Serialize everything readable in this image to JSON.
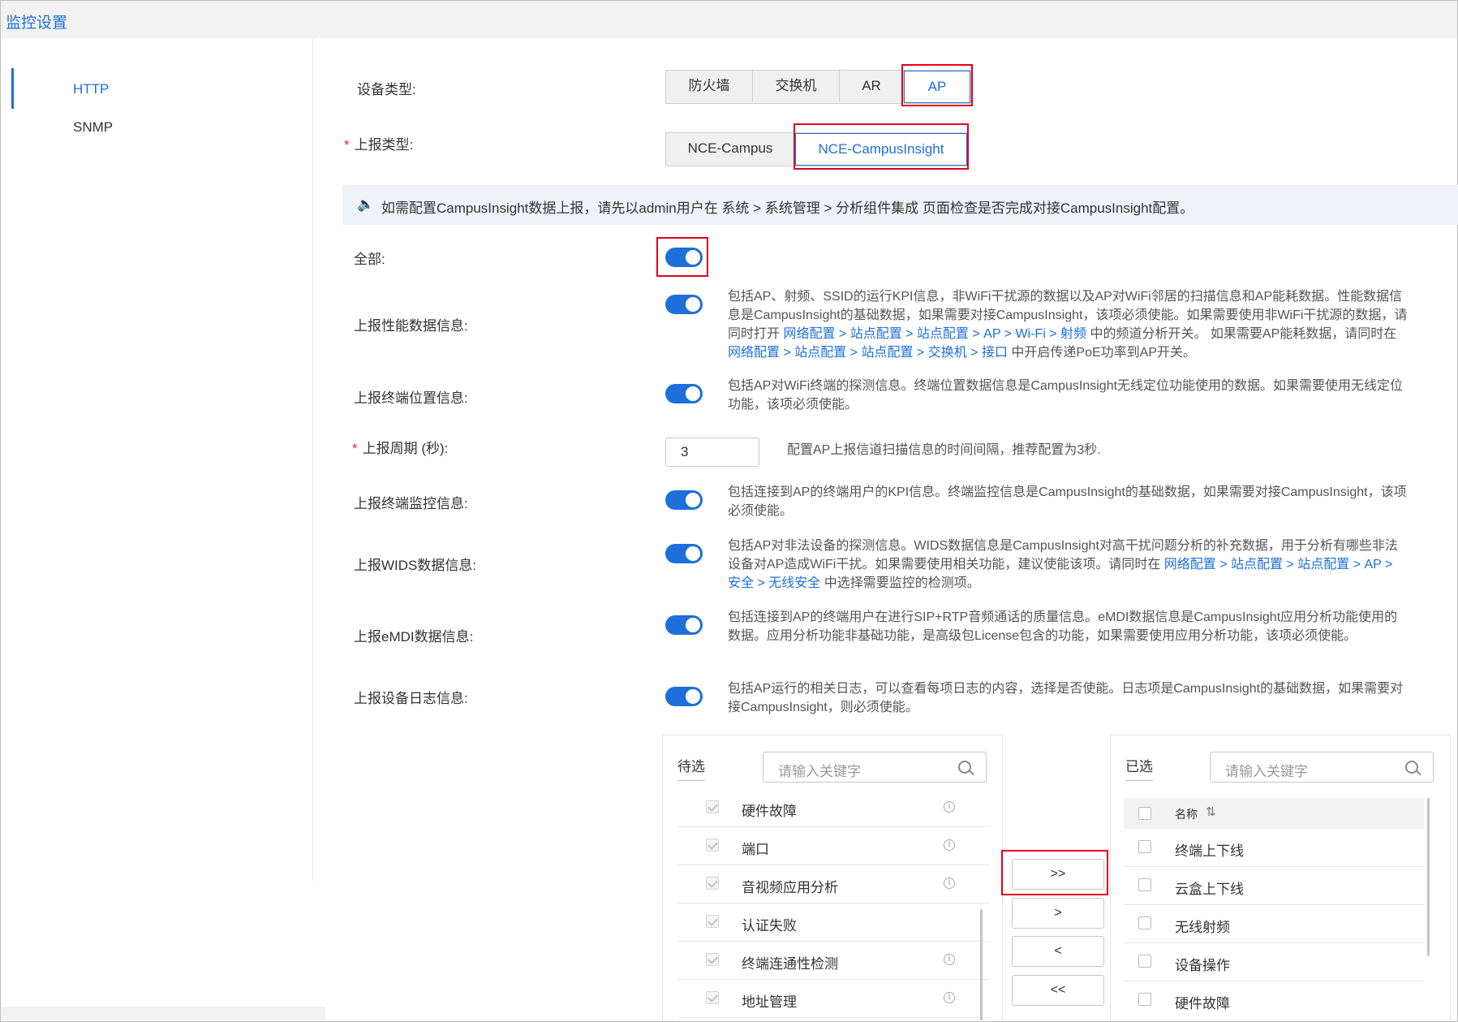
{
  "app": {
    "title": "监控设置"
  },
  "sidebar": {
    "items": [
      {
        "label": "HTTP",
        "active": true
      },
      {
        "label": "SNMP",
        "active": false
      }
    ]
  },
  "form": {
    "device_type": {
      "label": "设备类型:",
      "options": [
        "防火墙",
        "交换机",
        "AR",
        "AP"
      ],
      "selected": "AP"
    },
    "report_type": {
      "label": "上报类型:",
      "required": true,
      "options": [
        "NCE-Campus",
        "NCE-CampusInsight"
      ],
      "selected": "NCE-CampusInsight"
    },
    "notice": {
      "icon": "speaker-icon",
      "text": "如需配置CampusInsight数据上报，请先以admin用户在 系统 > 系统管理 > 分析组件集成 页面检查是否完成对接CampusInsight配置。"
    },
    "all": {
      "label": "全部:",
      "on": true
    },
    "perf": {
      "label": "上报性能数据信息:",
      "on": true,
      "desc_1": "包括AP、射频、SSID的运行KPI信息，非WiFi干扰源的数据以及AP对WiFi邻居的扫描信息和AP能耗数据。性能数据信息是CampusInsight的基础数据，如果需要对接CampusInsight，该项必须使能。如果需要使用非WiFi干扰源的数据，请同时打开 ",
      "link_1": "网络配置 > 站点配置 > 站点配置 > AP > Wi-Fi > 射频",
      "desc_2": " 中的频道分析开关。 如果需要AP能耗数据，请同时在 ",
      "link_2": "网络配置 > 站点配置 > 站点配置 > 交换机 > 接口",
      "desc_3": " 中开启传递PoE功率到AP开关。"
    },
    "location": {
      "label": "上报终端位置信息:",
      "on": true,
      "desc": "包括AP对WiFi终端的探测信息。终端位置数据信息是CampusInsight无线定位功能使用的数据。如果需要使用无线定位功能，该项必须使能。"
    },
    "period": {
      "label": "上报周期 (秒):",
      "required": true,
      "value": "3",
      "hint": "配置AP上报信道扫描信息的时间间隔，推荐配置为3秒."
    },
    "terminal": {
      "label": "上报终端监控信息:",
      "on": true,
      "desc": "包括连接到AP的终端用户的KPI信息。终端监控信息是CampusInsight的基础数据，如果需要对接CampusInsight，该项必须使能。"
    },
    "wids": {
      "label": "上报WIDS数据信息:",
      "on": true,
      "desc_1": "包括AP对非法设备的探测信息。WIDS数据信息是CampusInsight对高干扰问题分析的补充数据，用于分析有哪些非法设备对AP造成WiFi干扰。如果需要使用相关功能，建议使能该项。请同时在 ",
      "link_1": "网络配置 > 站点配置 > 站点配置 > AP > 安全 > 无线安全",
      "desc_2": " 中选择需要监控的检测项。"
    },
    "emdi": {
      "label": "上报eMDI数据信息:",
      "on": true,
      "desc": "包括连接到AP的终端用户在进行SIP+RTP音频通话的质量信息。eMDI数据信息是CampusInsight应用分析功能使用的数据。应用分析功能非基础功能，是高级包License包含的功能，如果需要使用应用分析功能，该项必须使能。"
    },
    "log": {
      "label": "上报设备日志信息:",
      "on": true,
      "desc": "包括AP运行的相关日志，可以查看每项日志的内容，选择是否使能。日志项是CampusInsight的基础数据，如果需要对接CampusInsight，则必须使能。"
    }
  },
  "transfer": {
    "left": {
      "title": "待选",
      "search_placeholder": "请输入关键字",
      "items": [
        {
          "label": "硬件故障",
          "info": true
        },
        {
          "label": "端口",
          "info": true
        },
        {
          "label": "音视频应用分析",
          "info": true
        },
        {
          "label": "认证失败",
          "info": false
        },
        {
          "label": "终端连通性检测",
          "info": true
        },
        {
          "label": "地址管理",
          "info": true
        }
      ]
    },
    "right": {
      "title": "已选",
      "search_placeholder": "请输入关键字",
      "column": "名称",
      "sort_icon": "sort-icon",
      "items": [
        "终端上下线",
        "云盒上下线",
        "无线射频",
        "设备操作",
        "硬件故障"
      ]
    },
    "buttons": {
      "all_right": ">>",
      "right": ">",
      "left": "<",
      "all_left": "<<"
    }
  }
}
